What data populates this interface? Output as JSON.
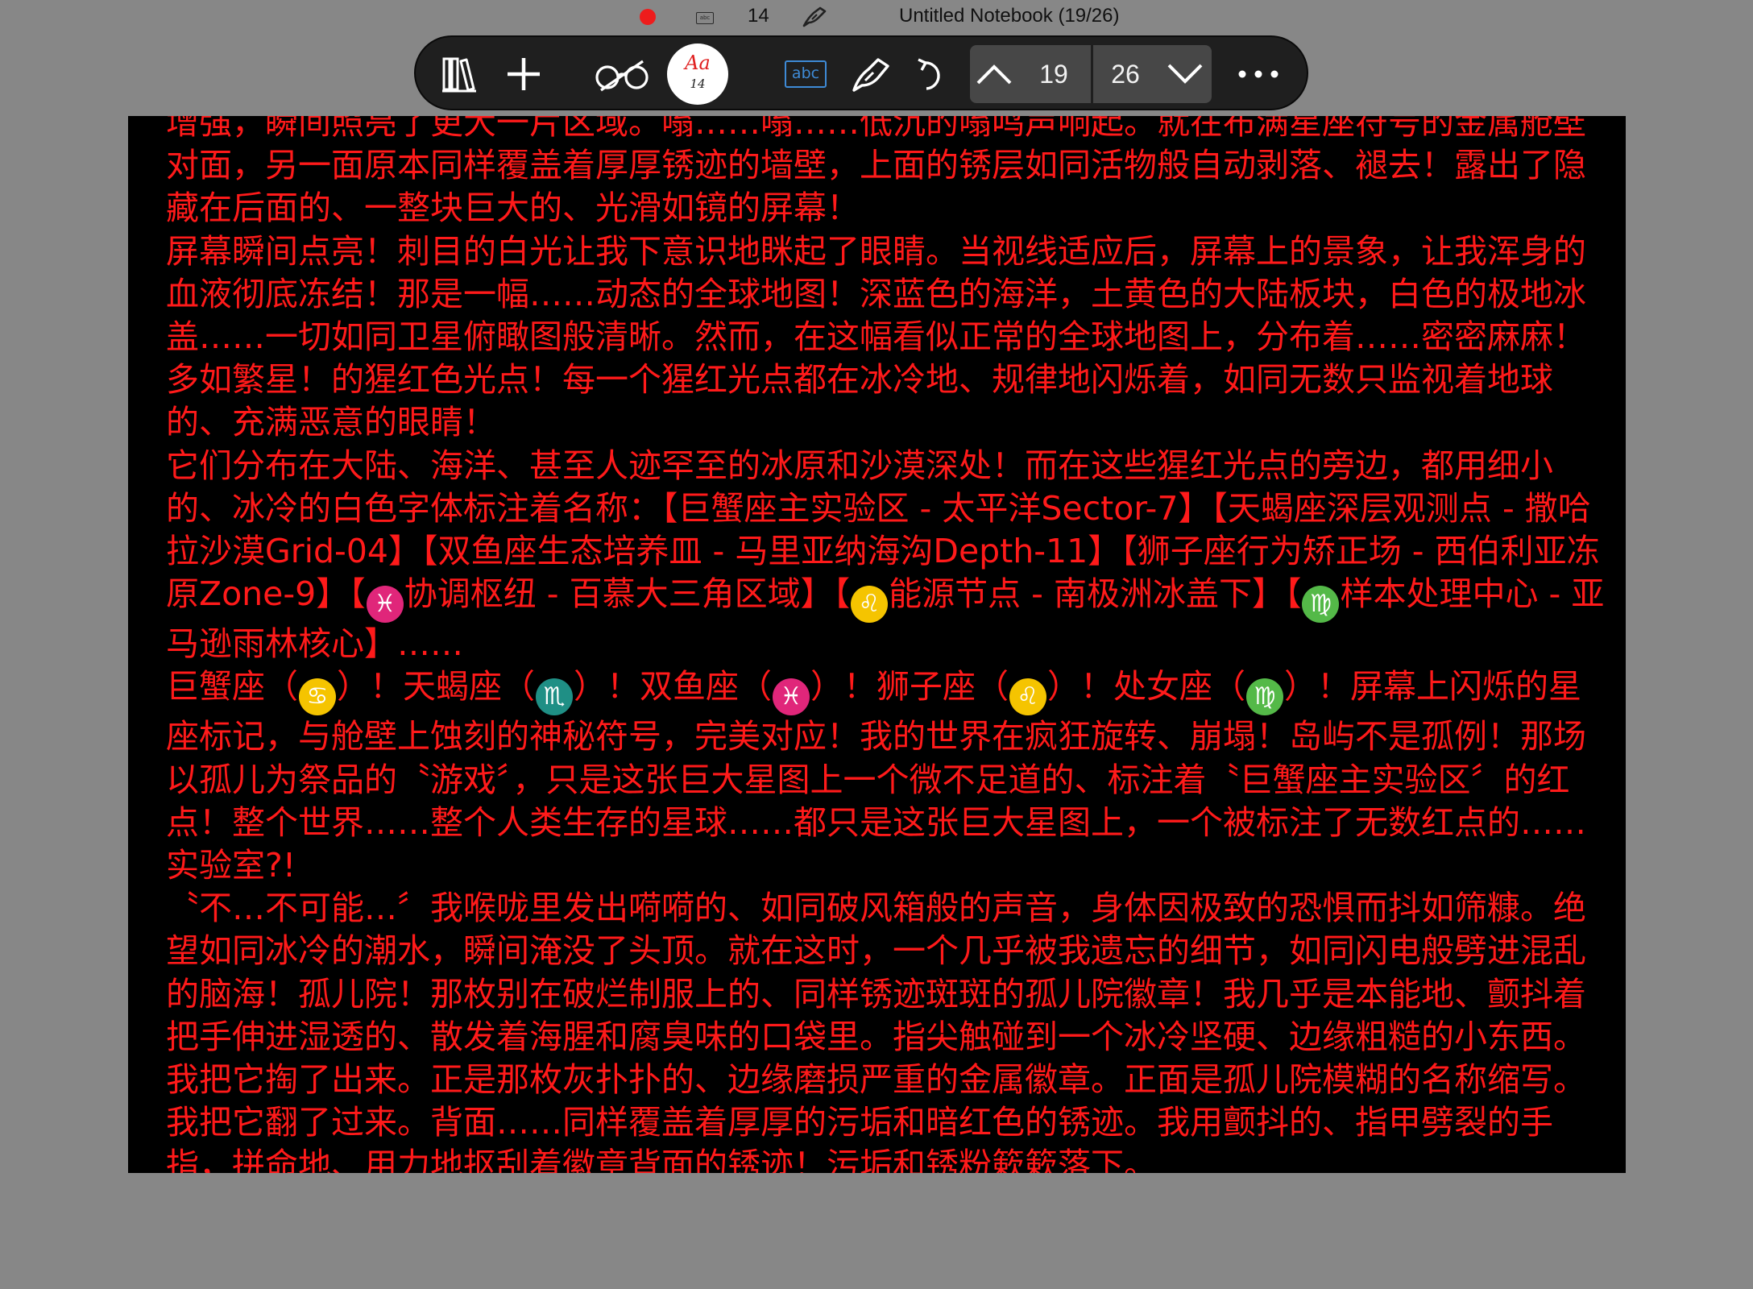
{
  "status_bar": {
    "record_color": "#ee1c1c",
    "mini_abc_label": "abc",
    "font_size": "14",
    "title": "Untitled Notebook (19/26)"
  },
  "toolbar": {
    "buttons": [
      {
        "name": "library",
        "icon": "books-icon"
      },
      {
        "name": "add",
        "icon": "plus-icon"
      },
      {
        "name": "reader",
        "icon": "glasses-icon"
      },
      {
        "name": "font",
        "icon": "font-style-icon",
        "label": "Aa",
        "size": "14"
      },
      {
        "name": "text",
        "icon": "text-box-icon",
        "label": "abc"
      },
      {
        "name": "pen",
        "icon": "pen-icon"
      },
      {
        "name": "undo",
        "icon": "undo-icon"
      }
    ],
    "page_nav": {
      "current": "19",
      "total": "26"
    },
    "more_icon": "more-horizontal-icon"
  },
  "colors": {
    "text": "#ff1a1a",
    "page_bg": "#000000",
    "canvas_bg": "#878787",
    "toolbar_bg": "#1f1f1f",
    "accent_blue": "#3e8ad6"
  },
  "document": {
    "paragraphs": [
      [
        {
          "t": "增强，瞬间照亮了更大一片区域。嗡……嗡……低沉的嗡鸣声响起。就在布满星座符号的金属舱壁对面，另一面原本同样覆盖着厚厚锈迹的墙壁，上面的锈层如同活物般自动剥落、褪去！露出了隐藏在后面的、一整块巨大的、光滑如镜的屏幕！"
        }
      ],
      [
        {
          "t": "屏幕瞬间点亮！刺目的白光让我下意识地眯起了眼睛。当视线适应后，屏幕上的景象，让我浑身的血液彻底冻结！那是一幅……动态的全球地图！深蓝色的海洋，土黄色的大陆板块，白色的极地冰盖……一切如同卫星俯瞰图般清晰。然而，在这幅看似正常的全球地图上，分布着……密密麻麻！多如繁星！的猩红色光点！每一个猩红光点都在冰冷地、规律地闪烁着，如同无数只监视着地球的、充满恶意的眼睛！"
        }
      ],
      [
        {
          "t": "它们分布在大陆、海洋、甚至人迹罕至的冰原和沙漠深处！而在这些猩红光点的旁边，都用细小的、冰冷的白色字体标注着名称：【巨蟹座主实验区 - 太平洋Sector-7】【天蝎座深层观测点 - 撒哈拉沙漠Grid-04】【双鱼座生态培养皿 - 马里亚纳海沟Depth-11】【狮子座行为矫正场 - 西伯利亚冻原Zone-9】【"
        },
        {
          "z": "♓",
          "c": "#e0267a"
        },
        {
          "t": "协调枢纽 - 百慕大三角区域】【"
        },
        {
          "z": "♌",
          "c": "#f5c400"
        },
        {
          "t": "能源节点 - 南极洲冰盖下】【"
        },
        {
          "z": "♍",
          "c": "#54b948"
        },
        {
          "t": "样本处理中心 - 亚马逊雨林核心】……"
        }
      ],
      [
        {
          "t": "巨蟹座（"
        },
        {
          "z": "♋",
          "c": "#f5c400"
        },
        {
          "t": "）！天蝎座（"
        },
        {
          "z": "♏",
          "c": "#1f8f85"
        },
        {
          "t": "）！双鱼座（"
        },
        {
          "z": "♓",
          "c": "#e0267a"
        },
        {
          "t": "）！狮子座（"
        },
        {
          "z": "♌",
          "c": "#f5c400"
        },
        {
          "t": "）！处女座（"
        },
        {
          "z": "♍",
          "c": "#54b948"
        },
        {
          "t": "）！屏幕上闪烁的星座标记，与舱壁上蚀刻的神秘符号，完美对应！我的世界在疯狂旋转、崩塌！岛屿不是孤例！那场以孤儿为祭品的〝游戏〞，只是这张巨大星图上一个微不足道的、标注着〝巨蟹座主实验区〞的红点！整个世界……整个人类生存的星球……都只是这张巨大星图上，一个被标注了无数红点的……实验室?!"
        }
      ],
      [
        {
          "t": "〝不…不可能…〞我喉咙里发出嗬嗬的、如同破风箱般的声音，身体因极致的恐惧而抖如筛糠。绝望如同冰冷的潮水，瞬间淹没了头顶。就在这时，一个几乎被我遗忘的细节，如同闪电般劈进混乱的脑海！孤儿院！那枚别在破烂制服上的、同样锈迹斑斑的孤儿院徽章！我几乎是本能地、颤抖着把手伸进湿透的、散发着海腥和腐臭味的口袋里。指尖触碰到一个冰冷坚硬、边缘粗糙的小东西。我把它掏了出来。正是那枚灰扑扑的、边缘磨损严重的金属徽章。正面是孤儿院模糊的名称缩写。我把它翻了过来。背面……同样覆盖着厚厚的污垢和暗红色的锈迹。我用颤抖的、指甲劈裂的手指，拼命地、用力地抠刮着徽章背面的锈迹！污垢和锈粉簌簌落下。"
        }
      ]
    ]
  }
}
